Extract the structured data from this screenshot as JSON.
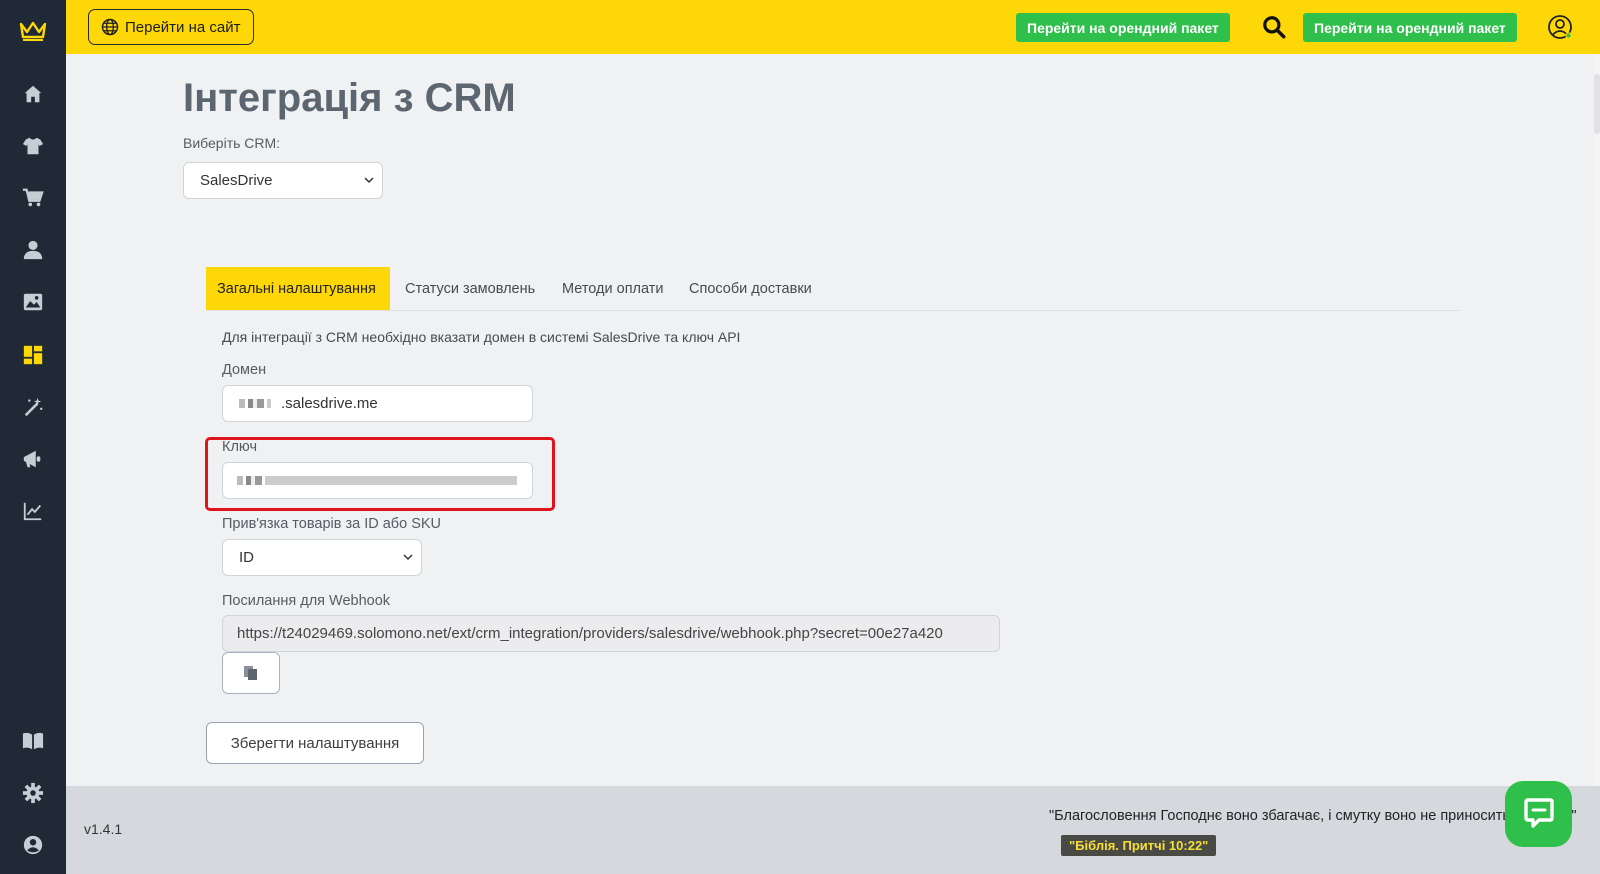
{
  "sidebar": {
    "logo": "crown-logo",
    "items": [
      {
        "icon": "home-icon"
      },
      {
        "icon": "tshirt-icon"
      },
      {
        "icon": "cart-icon"
      },
      {
        "icon": "user-icon"
      },
      {
        "icon": "image-icon"
      },
      {
        "icon": "dashboard-icon"
      },
      {
        "icon": "magic-wand-icon"
      },
      {
        "icon": "megaphone-icon"
      },
      {
        "icon": "chart-line-icon"
      },
      {
        "icon": "book-icon"
      },
      {
        "icon": "gear-icon"
      },
      {
        "icon": "account-circle-icon"
      }
    ]
  },
  "topbar": {
    "site_button": "Перейти на сайт",
    "rent_button_1": "Перейти на орендний пакет",
    "rent_button_2": "Перейти на орендний пакет",
    "accent": "#fdd708",
    "green": "#2fbf4b"
  },
  "main": {
    "title": "Інтеграція з CRM",
    "crm_label": "Виберіть CRM:",
    "crm_selected": "SalesDrive",
    "tabs": [
      {
        "label": "Загальні налаштування",
        "active": true
      },
      {
        "label": "Статуси замовлень",
        "active": false
      },
      {
        "label": "Методи оплати",
        "active": false
      },
      {
        "label": "Способи доставки",
        "active": false
      }
    ],
    "info": "Для інтеграції з CRM необхідно вказати домен в системі SalesDrive та ключ API",
    "domain_label": "Домен",
    "domain_suffix": ".salesdrive.me",
    "key_label": "Ключ",
    "binding_label": "Прив'язка товарів за ID або SKU",
    "binding_selected": "ID",
    "webhook_label": "Посилання для Webhook",
    "webhook_value": "https://t24029469.solomono.net/ext/crm_integration/providers/salesdrive/webhook.php?secret=00e27a420",
    "save_button": "Зберегти налаштування"
  },
  "footer": {
    "version": "v1.4.1",
    "quote": "\"Благословення Господнє воно збагачає, і смутку воно не приносить з собою.\"",
    "quote_source": "\"Біблія. Притчі 10:22\""
  }
}
